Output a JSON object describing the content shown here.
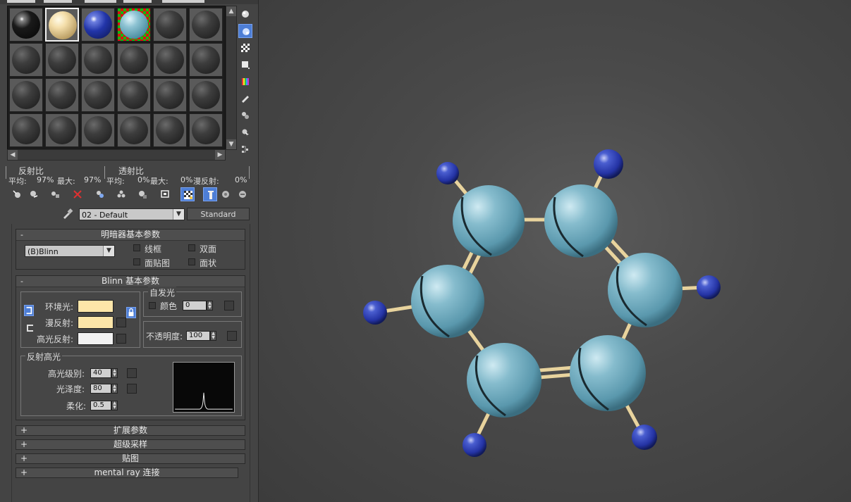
{
  "colors": {
    "panel_bg": "#444444",
    "viewport_bg": "#4a4a4a",
    "accent": "#4d7ed6",
    "ambient_swatch": "#fde6a9",
    "diffuse_swatch": "#fde6a9",
    "specular_swatch": "#f2f2f2",
    "carbon": "#6fa7bb",
    "hydrogen": "#2a3cb0",
    "bond": "#e8d39d"
  },
  "material_slots": [
    {
      "type": "black-glossy"
    },
    {
      "type": "cream",
      "selected": true
    },
    {
      "type": "blue"
    },
    {
      "type": "teal-checker"
    },
    {
      "type": "default"
    },
    {
      "type": "default"
    },
    {
      "type": "default"
    },
    {
      "type": "default"
    },
    {
      "type": "default"
    },
    {
      "type": "default"
    },
    {
      "type": "default"
    },
    {
      "type": "default"
    },
    {
      "type": "default"
    },
    {
      "type": "default"
    },
    {
      "type": "default"
    },
    {
      "type": "default"
    },
    {
      "type": "default"
    },
    {
      "type": "default"
    },
    {
      "type": "default"
    },
    {
      "type": "default"
    },
    {
      "type": "default"
    },
    {
      "type": "default"
    },
    {
      "type": "default"
    },
    {
      "type": "default"
    }
  ],
  "side_tools": [
    "sample-type-icon",
    "backlight-icon",
    "background-icon",
    "sample-uv-icon",
    "video-color-icon",
    "make-preview-icon",
    "options-icon",
    "select-by-material-icon",
    "material-navigator-icon"
  ],
  "reflect": {
    "reflect_label": "反射比",
    "transmit_label": "透射比",
    "avg_label": "平均:",
    "avg_value": "97%",
    "max_label": "最大:",
    "max_value": "97%",
    "t_avg_label": "平均:",
    "t_avg_value": "0%",
    "t_max_label": "最大:",
    "t_max_value": "0%",
    "diffuse_label": "漫反射:",
    "diffuse_value": "0%"
  },
  "toolbar_icons": [
    "get-material-icon",
    "put-to-scene-icon",
    "assign-material-icon",
    "reset-icon",
    "make-copy-icon",
    "make-unique-icon",
    "put-to-library-icon",
    "material-id-icon",
    "show-map-icon",
    "show-end-result-icon",
    "go-parent-icon",
    "go-sibling-icon"
  ],
  "material": {
    "name": "02 - Default",
    "type_button": "Standard"
  },
  "shader": {
    "title": "明暗器基本参数",
    "collapse": "-",
    "shader_value": "(B)Blinn",
    "wire_label": "线框",
    "two_sided_label": "双面",
    "face_map_label": "面贴图",
    "faceted_label": "面状"
  },
  "blinn": {
    "title": "Blinn 基本参数",
    "collapse": "-",
    "ambient_label": "环境光:",
    "diffuse_label": "漫反射:",
    "specular_label": "高光反射:",
    "self_illum_title": "自发光",
    "color_label": "颜色",
    "self_illum_value": "0",
    "opacity_label": "不透明度:",
    "opacity_value": "100",
    "spec_title": "反射高光",
    "spec_level_label": "高光级别:",
    "spec_level_value": "40",
    "gloss_label": "光泽度:",
    "gloss_value": "80",
    "soften_label": "柔化:",
    "soften_value": "0.5"
  },
  "rollouts": [
    {
      "sign": "+",
      "label": "扩展参数"
    },
    {
      "sign": "+",
      "label": "超级采样"
    },
    {
      "sign": "+",
      "label": "贴图"
    },
    {
      "sign": "+",
      "label": "mental ray 连接"
    }
  ]
}
